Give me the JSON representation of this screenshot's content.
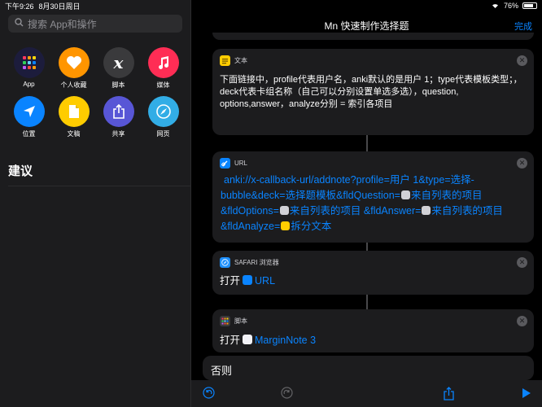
{
  "status": {
    "time": "下午9:26",
    "date": "8月30日周日",
    "battery": "76%"
  },
  "sidebar": {
    "search_placeholder": "搜索 App和操作",
    "apps": [
      {
        "label": "App",
        "color": "#1c1c3c",
        "icon": "app-grid-icon"
      },
      {
        "label": "个人收藏",
        "color": "#ff9500",
        "icon": "heart-icon"
      },
      {
        "label": "脚本",
        "color": "#3a3a3c",
        "icon": "script-x-icon"
      },
      {
        "label": "媒体",
        "color": "#ff2d55",
        "icon": "music-note-icon"
      },
      {
        "label": "位置",
        "color": "#0a84ff",
        "icon": "location-arrow-icon"
      },
      {
        "label": "文稿",
        "color": "#ffcc00",
        "icon": "document-icon"
      },
      {
        "label": "共享",
        "color": "#5856d6",
        "icon": "share-icon"
      },
      {
        "label": "网页",
        "color": "#32ade6",
        "icon": "compass-icon"
      }
    ],
    "suggestions_title": "建议"
  },
  "main": {
    "title": "Mn 快速制作选择题",
    "done": "完成",
    "text_card": {
      "label": "文本",
      "content": "下面链接中，profile代表用户名，anki默认的是用户 1；type代表模板类型；，deck代表卡组名称（自己可以分别设置单选多选），question, options,answer，analyze分别 = 索引各项目"
    },
    "url_card": {
      "label": "URL",
      "line1": "anki://x-callback-url/addnote?profile=用户 1&type=选择-",
      "line2a": "bubble&deck=选择题模板&fldQuestion=",
      "line2b": "来自列表的项目",
      "line3a": "&fldOptions=",
      "line3b": "来自列表的项目 &fldAnswer=",
      "line3c": "来自列表的项目",
      "line4a": "&fldAnalyze=",
      "line4b": "拆分文本"
    },
    "safari_card": {
      "label": "SAFARI 浏览器",
      "verb": "打开",
      "token": "URL"
    },
    "script_card": {
      "label": "脚本",
      "verb": "打开",
      "token": "MarginNote 3"
    },
    "else_label": "否则"
  },
  "colors": {
    "accent": "#0a84ff"
  }
}
